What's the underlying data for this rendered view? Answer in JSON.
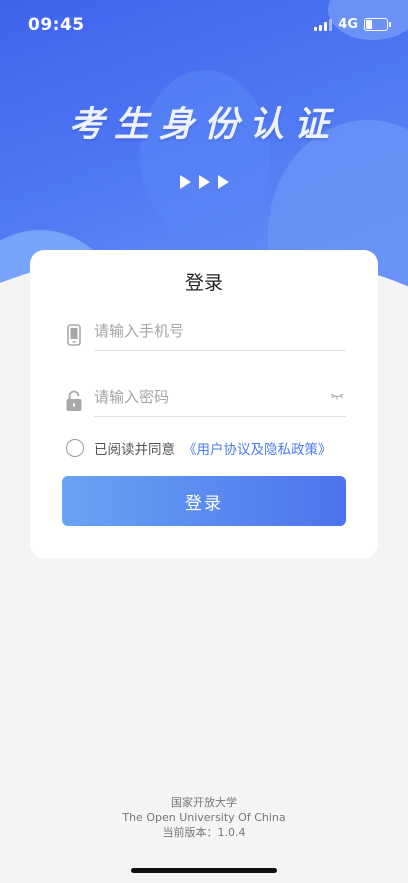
{
  "status_bar": {
    "time": "09:45",
    "network": "4G"
  },
  "hero": {
    "title": "考生身份认证"
  },
  "login_card": {
    "title": "登录",
    "phone_placeholder": "请输入手机号",
    "password_placeholder": "请输入密码",
    "agree_text": "已阅读并同意",
    "agree_link": "《用户协议及隐私政策》",
    "button_label": "登录"
  },
  "footer": {
    "org_cn": "国家开放大学",
    "org_en": "The Open University Of China",
    "version": "当前版本：1.0.4"
  },
  "colors": {
    "brand": "#4a6ff0",
    "link": "#4a7bef"
  },
  "icons": [
    "phone-icon",
    "lock-icon",
    "eye-closed-icon",
    "arrow-right-icon"
  ]
}
